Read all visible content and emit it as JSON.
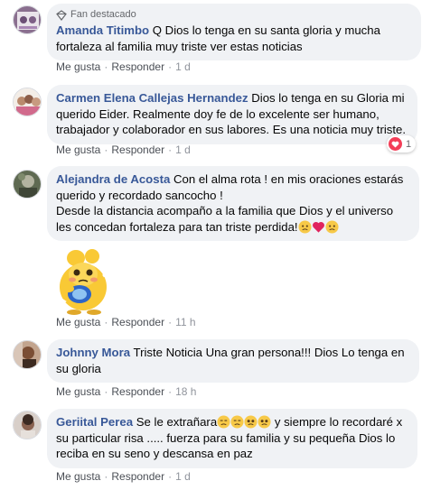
{
  "comments": [
    {
      "badge": "Fan destacado",
      "author": "Amanda Titimbo",
      "text": "Q Dios lo tenga en su santa gloria y mucha fortaleza al familia muy triste ver estas noticias",
      "like": "Me gusta",
      "reply": "Responder",
      "time": "1 d"
    },
    {
      "author": "Carmen Elena Callejas Hernandez",
      "text": "Dios lo tenga en su Gloria mi querido Eider. Realmente doy fe de lo excelente ser humano, trabajador y colaborador en sus labores. Es una noticia muy triste.",
      "like": "Me gusta",
      "reply": "Responder",
      "time": "1 d",
      "reaction_count": "1"
    },
    {
      "author": "Alejandra de Acosta",
      "text_line1": "Con el alma rota ! en mis oraciones estarás querido y recordado sancocho !",
      "text_line2": "Desde la distancia acompaño a la familia que Dios y el universo les concedan fortaleza para tan triste perdida!",
      "like": "Me gusta",
      "reply": "Responder",
      "time": "11 h"
    },
    {
      "author": "Johnny Mora",
      "text": "Triste Noticia Una gran persona!!! Dios Lo tenga en su gloria",
      "like": "Me gusta",
      "reply": "Responder",
      "time": "18 h"
    },
    {
      "author": "Geriital Perea",
      "text_part1": "Se le extrañara",
      "text_part2": "y siempre lo recordaré x su particular risa ..... fuerza para su familia y su pequeña Dios lo reciba en su seno y descansa en paz",
      "like": "Me gusta",
      "reply": "Responder",
      "time": "1 d"
    }
  ],
  "colors": {
    "author": "#385898",
    "bubble": "#f0f2f5",
    "meta": "#65676b",
    "heart": "#f33e58"
  },
  "icons": [
    "star-badge-icon",
    "heart-reaction-icon",
    "sad-emoji-icon",
    "heart-emoji-icon",
    "sticker-image"
  ]
}
